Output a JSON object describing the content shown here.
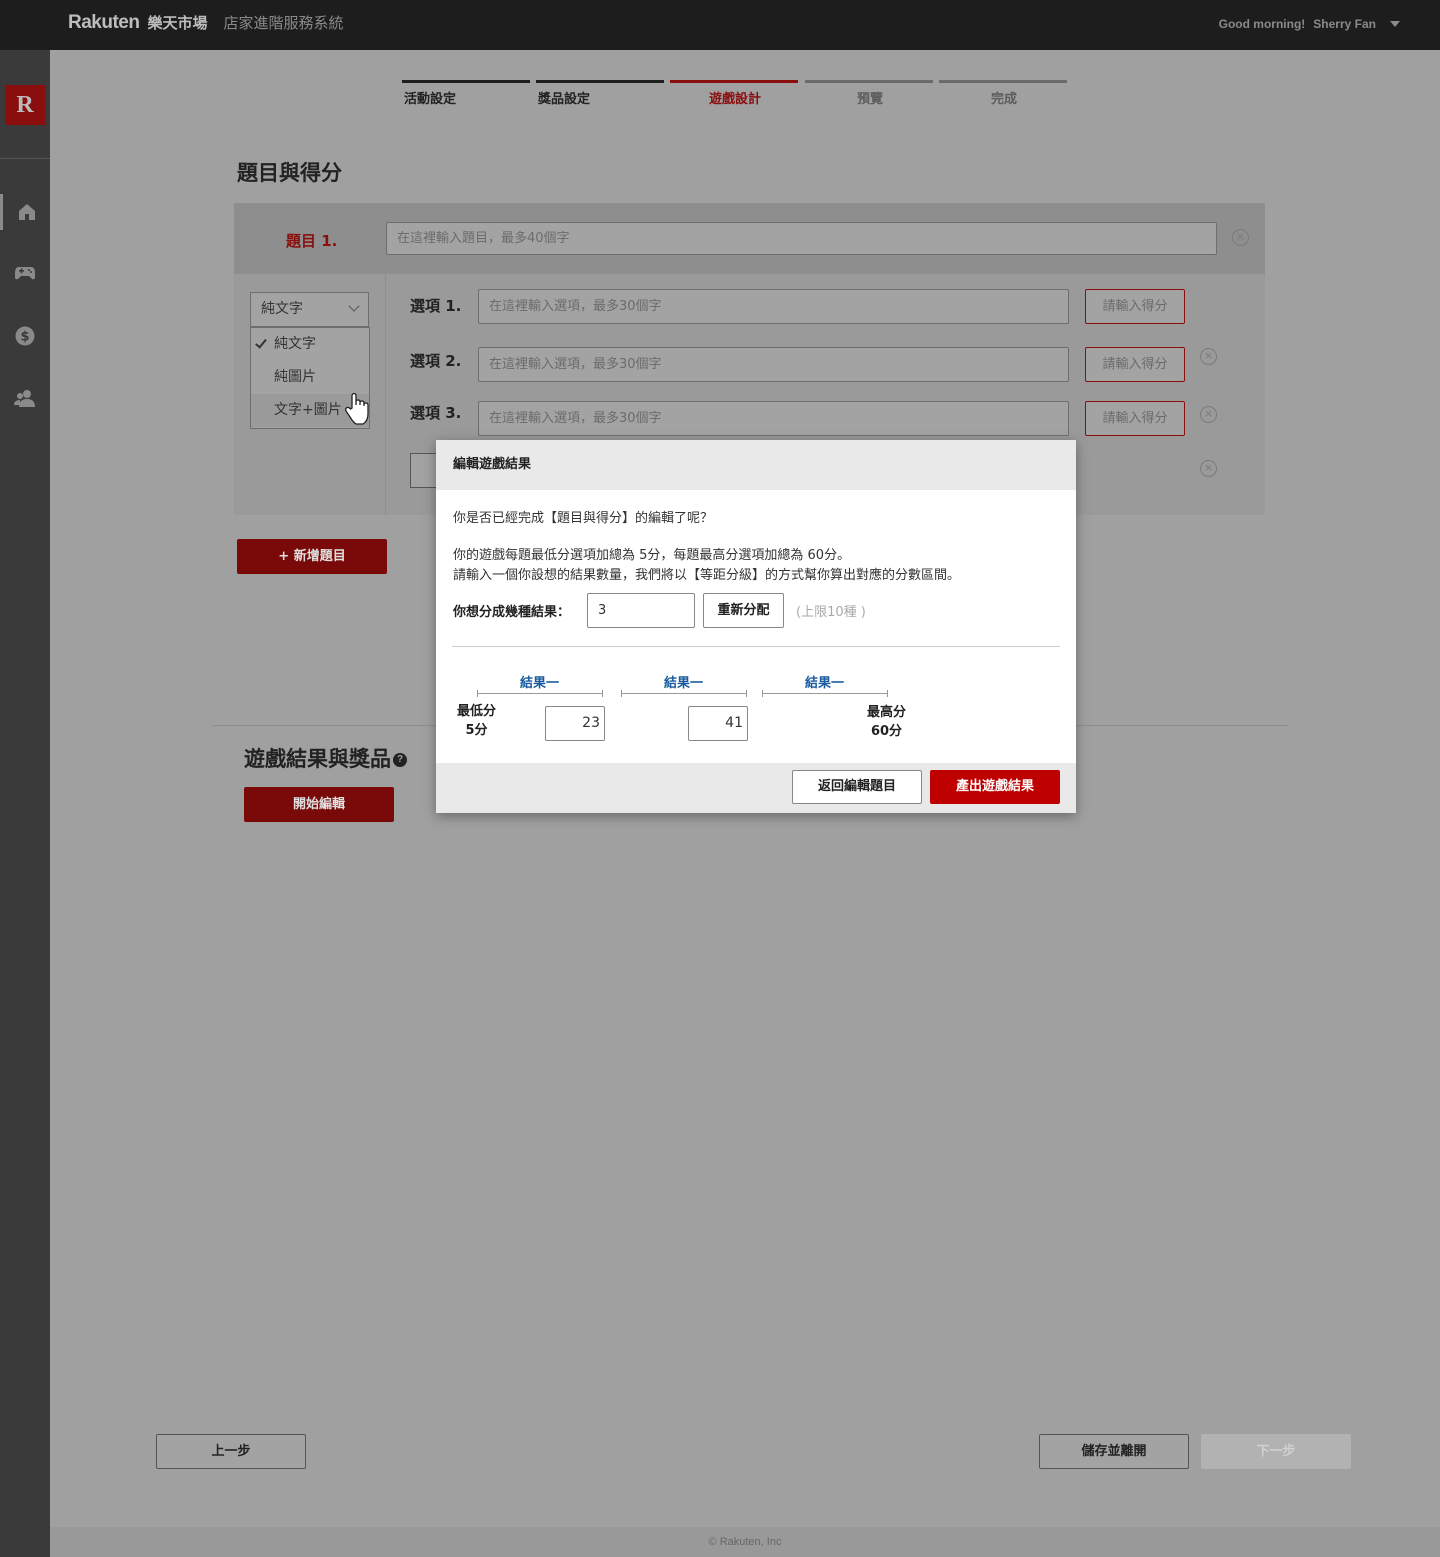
{
  "header": {
    "logo": "Rakuten",
    "market": "樂天市場",
    "system": "店家進階服務系統",
    "greeting": "Good morning!",
    "user": "Sherry Fan"
  },
  "sidebar": {
    "logo": "R",
    "items": [
      {
        "icon": "home-icon"
      },
      {
        "icon": "gamepad-icon"
      },
      {
        "icon": "dollar-icon"
      },
      {
        "icon": "users-icon"
      }
    ]
  },
  "stepper": {
    "steps": [
      "活動設定",
      "獎品設定",
      "遊戲設計",
      "預覽",
      "完成"
    ],
    "current": "遊戲設計"
  },
  "questions": {
    "title": "題目與得分",
    "q1_label": "題目 1.",
    "q1_placeholder": "在這裡輸入題目，最多40個字",
    "type_select": {
      "value": "純文字",
      "options": [
        "純文字",
        "純圖片",
        "文字+圖片"
      ]
    },
    "options": [
      {
        "label": "選項 1.",
        "placeholder": "在這裡輸入選項，最多30個字",
        "score_placeholder": "請輸入得分"
      },
      {
        "label": "選項 2.",
        "placeholder": "在這裡輸入選項，最多30個字",
        "score_placeholder": "請輸入得分"
      },
      {
        "label": "選項 3.",
        "placeholder": "在這裡輸入選項，最多30個字",
        "score_placeholder": "請輸入得分"
      }
    ],
    "add_question": "+ 新增題目"
  },
  "results_section": {
    "title": "遊戲結果與獎品",
    "help": "?",
    "start_edit": "開始編輯"
  },
  "nav": {
    "prev": "上一步",
    "save_exit": "儲存並離開",
    "next": "下一步"
  },
  "footer": "© Rakuten, Inc",
  "modal": {
    "title": "編輯遊戲結果",
    "question": "你是否已經完成【題目與得分】的編輯了呢？",
    "info1": "你的遊戲每題最低分選項加總為 5分，每題最高分選項加總為 60分。",
    "info2": "請輸入一個你設想的結果數量，我們將以【等距分級】的方式幫你算出對應的分數區間。",
    "count_label": "你想分成幾種結果：",
    "count_value": "3",
    "redistribute": "重新分配",
    "limit_hint": "(上限10種 )",
    "ranges": [
      "結果一",
      "結果一",
      "結果一"
    ],
    "min_label": "最低分",
    "min_value": "5分",
    "max_label": "最高分",
    "max_value": "60分",
    "breakpoints": [
      "23",
      "41"
    ],
    "back": "返回編輯題目",
    "generate": "產出遊戲結果"
  }
}
